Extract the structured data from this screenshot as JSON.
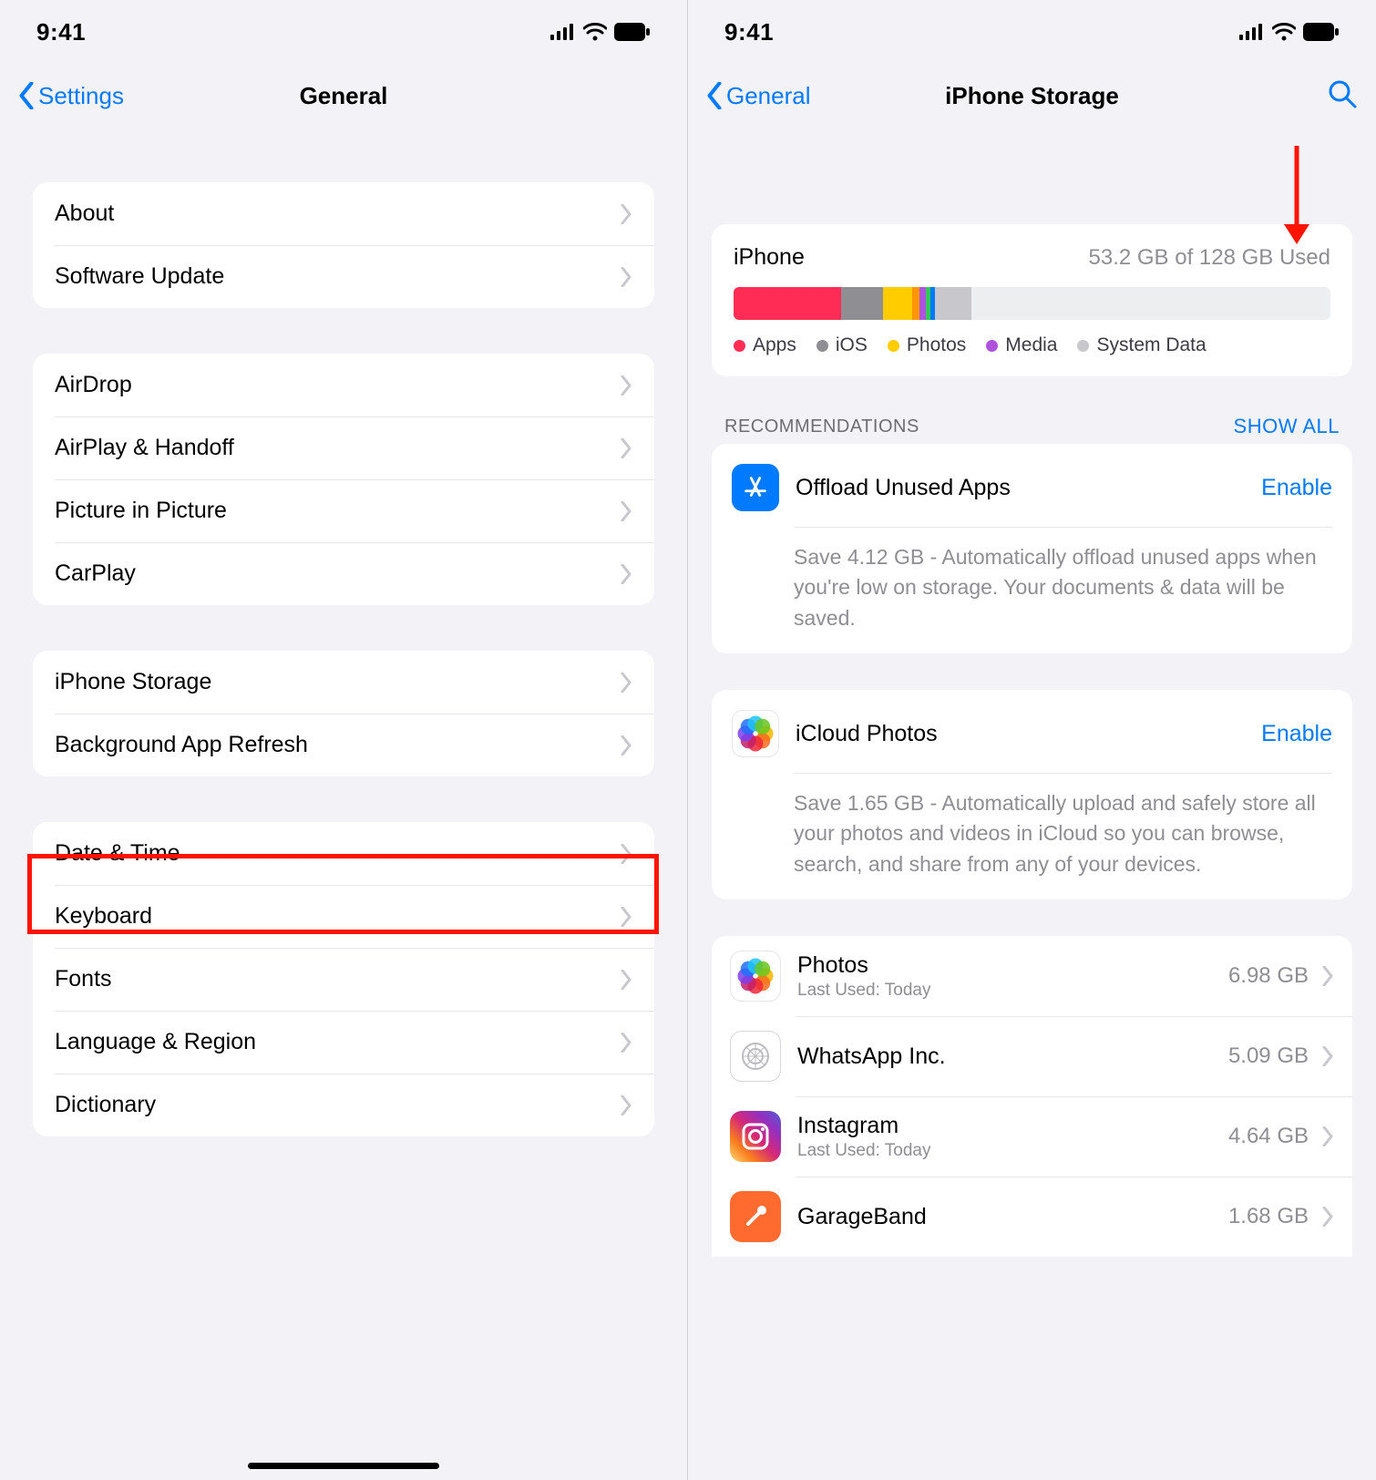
{
  "status": {
    "time": "9:41"
  },
  "left": {
    "back": "Settings",
    "title": "General",
    "groups": [
      {
        "rows": [
          "About",
          "Software Update"
        ]
      },
      {
        "rows": [
          "AirDrop",
          "AirPlay & Handoff",
          "Picture in Picture",
          "CarPlay"
        ]
      },
      {
        "rows": [
          "iPhone Storage",
          "Background App Refresh"
        ]
      },
      {
        "rows": [
          "Date & Time",
          "Keyboard",
          "Fonts",
          "Language & Region",
          "Dictionary"
        ]
      }
    ],
    "highlighted_row": "iPhone Storage"
  },
  "right": {
    "back": "General",
    "title": "iPhone Storage",
    "storage": {
      "device": "iPhone",
      "used_text": "53.2 GB of 128 GB Used",
      "segments": [
        {
          "label": "Apps",
          "color": "#ff2d55",
          "pct": 18
        },
        {
          "label": "iOS",
          "color": "#8e8e93",
          "pct": 7
        },
        {
          "label": "Photos",
          "color": "#ffcc00",
          "pct": 5
        },
        {
          "label": "",
          "color": "#ff9500",
          "pct": 1.2
        },
        {
          "label": "Media",
          "color": "#af52de",
          "pct": 1
        },
        {
          "label": "",
          "color": "#34c759",
          "pct": 0.8
        },
        {
          "label": "",
          "color": "#007aff",
          "pct": 0.8
        },
        {
          "label": "System Data",
          "color": "#c7c7cc",
          "pct": 6
        }
      ],
      "legend": [
        {
          "label": "Apps",
          "color": "#ff2d55"
        },
        {
          "label": "iOS",
          "color": "#8e8e93"
        },
        {
          "label": "Photos",
          "color": "#ffcc00"
        },
        {
          "label": "Media",
          "color": "#af52de"
        },
        {
          "label": "System Data",
          "color": "#c7c7cc"
        }
      ]
    },
    "recommendations_header": "RECOMMENDATIONS",
    "show_all": "SHOW ALL",
    "recommendations": [
      {
        "icon": "appstore",
        "title": "Offload Unused Apps",
        "action": "Enable",
        "desc": "Save 4.12 GB - Automatically offload unused apps when you're low on storage. Your documents & data will be saved."
      },
      {
        "icon": "photos",
        "title": "iCloud Photos",
        "action": "Enable",
        "desc": "Save 1.65 GB - Automatically upload and safely store all your photos and videos in iCloud so you can browse, search, and share from any of your devices."
      }
    ],
    "apps": [
      {
        "icon": "photos",
        "name": "Photos",
        "sub": "Last Used: Today",
        "size": "6.98 GB"
      },
      {
        "icon": "whatsapp",
        "name": "WhatsApp Inc.",
        "sub": "",
        "size": "5.09 GB"
      },
      {
        "icon": "insta",
        "name": "Instagram",
        "sub": "Last Used: Today",
        "size": "4.64 GB"
      },
      {
        "icon": "gb",
        "name": "GarageBand",
        "sub": "",
        "size": "1.68 GB"
      }
    ]
  }
}
